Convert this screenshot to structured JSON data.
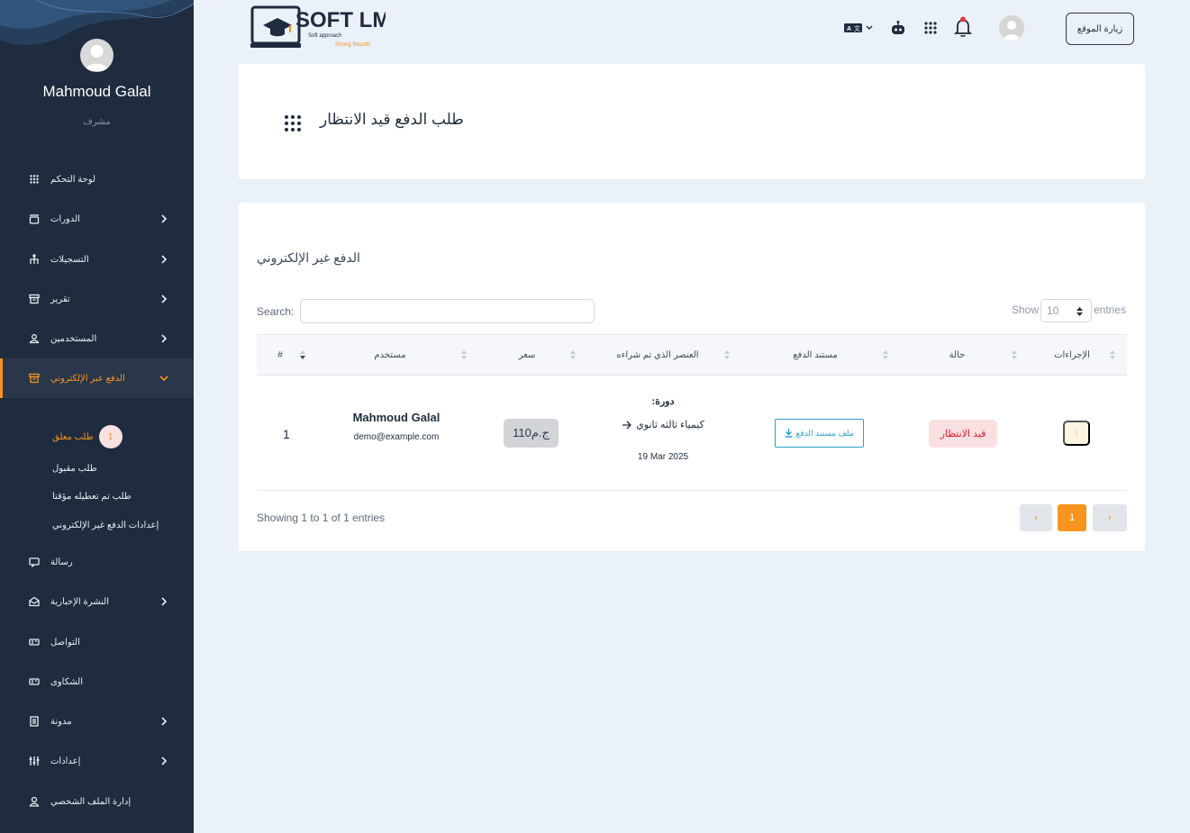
{
  "sidebar": {
    "user_name": "Mahmoud Galal",
    "user_role": "مشرف",
    "items": [
      {
        "label": "لوحة التحكم"
      },
      {
        "label": "الدورات"
      },
      {
        "label": "التسجيلات"
      },
      {
        "label": "تقرير"
      },
      {
        "label": "المستخدمين"
      },
      {
        "label": "الدفع عبر الإلكتروني"
      },
      {
        "label": "رسالة"
      },
      {
        "label": "النشرة الإخبارية"
      },
      {
        "label": "التواصل"
      },
      {
        "label": "الشكاوى"
      },
      {
        "label": "مدونة"
      },
      {
        "label": "إعدادات"
      },
      {
        "label": "إدارة الملف الشخصي"
      }
    ],
    "subitems": [
      {
        "label": "طلب معلق",
        "badge": "1"
      },
      {
        "label": "طلب مقبول"
      },
      {
        "label": "طلب تم تعطيله مؤقتا"
      },
      {
        "label": "إعدادات الدفع غير الإلكتروني"
      }
    ]
  },
  "topbar": {
    "logo_main": "SOFT LMS",
    "logo_sub1": "Soft approach",
    "logo_sub2": "Strong Results",
    "visit_site": "زيارة الموقع"
  },
  "page": {
    "title": "طلب الدفع قيد الانتظار"
  },
  "section": {
    "title": "الدفع غير الإلكتروني",
    "search_label": "Search:",
    "show_label": "Show",
    "show_value": "10",
    "entries_label": "entries",
    "columns": [
      "#",
      "مستخدم",
      "سعر",
      "العنصر الذي تم شراءه",
      "مستند الدفع",
      "حالة",
      "الإجراءات"
    ],
    "rows": [
      {
        "index": "1",
        "user_name": "Mahmoud Galal",
        "user_email": "demo@example.com",
        "price": "110ج.م",
        "item_type": ":دورة",
        "item_name": "كيمياء ثالثه ثانوي",
        "item_date": "19 Mar 2025",
        "doc_button": "ملف مستند الدفع",
        "status": "قيد الانتظار",
        "action": "⋮"
      }
    ],
    "showing": "Showing 1 to 1 of 1 entries",
    "pagination": {
      "prev": "‹",
      "current": "1",
      "next": "›"
    }
  },
  "colors": {
    "accent": "#f7941d",
    "sidebar_bg": "#1f2b3e",
    "status_bg": "#fbe0e2",
    "status_text": "#d71f2f",
    "doc_button": "#2aa0c9"
  },
  "icons": [
    "grid-icon",
    "course-icon",
    "registrations-icon",
    "report-icon",
    "users-icon",
    "payment-icon",
    "message-icon",
    "newsletter-icon",
    "contact-icon",
    "complaints-icon",
    "blog-icon",
    "settings-icon",
    "profile-icon",
    "language-icon",
    "robot-icon",
    "apps-icon",
    "bell-icon",
    "download-icon",
    "arrow-right-icon"
  ]
}
